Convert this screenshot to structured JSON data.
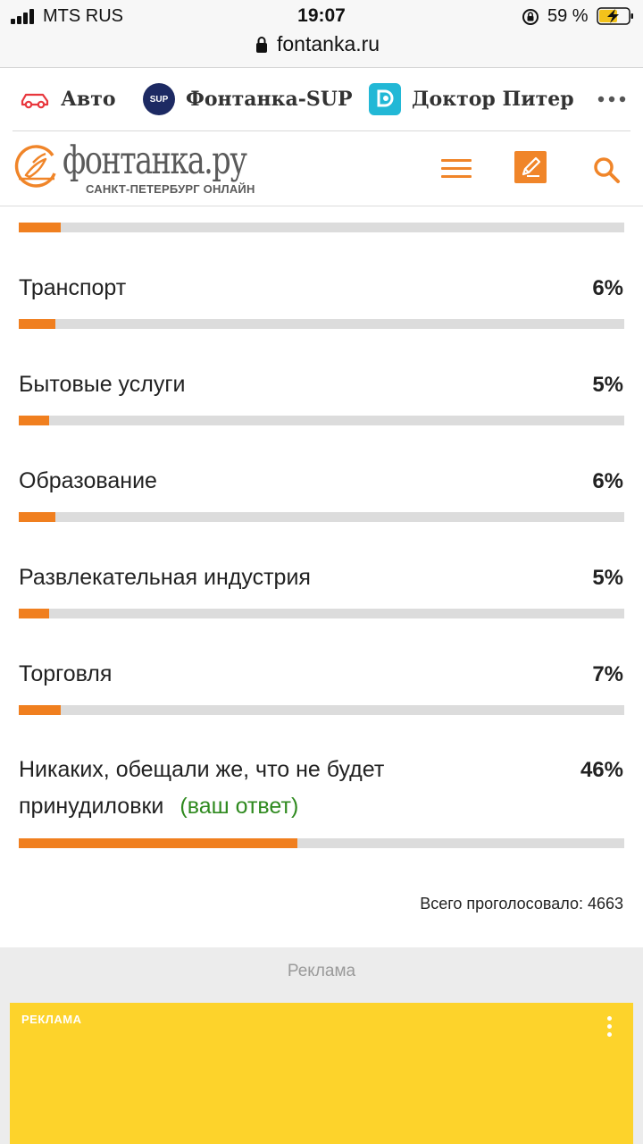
{
  "status_bar": {
    "carrier": "MTS RUS",
    "time": "19:07",
    "battery": "59 %"
  },
  "browser": {
    "url": "fontanka.ru"
  },
  "services": {
    "items": [
      {
        "label": "Авто",
        "icon": "car-icon"
      },
      {
        "label": "Фонтанка-SUP",
        "icon": "sup-logo",
        "icon_text": "SUP"
      },
      {
        "label": "Доктор Питер",
        "icon": "doctor-piter-logo"
      }
    ],
    "more_icon": "more-dots-icon"
  },
  "site_header": {
    "logo_text": "фонтанка.ру",
    "logo_subtitle": "САНКТ-ПЕТЕРБУРГ ОНЛАЙН",
    "accent_color": "#f08529"
  },
  "poll": {
    "options": [
      {
        "label": "",
        "percent": "",
        "fill": 0.07
      },
      {
        "label": "Транспорт",
        "percent": "6%",
        "fill": 0.06
      },
      {
        "label": "Бытовые услуги",
        "percent": "5%",
        "fill": 0.05
      },
      {
        "label": "Образование",
        "percent": "6%",
        "fill": 0.06
      },
      {
        "label": "Развлекательная индустрия",
        "percent": "5%",
        "fill": 0.05
      },
      {
        "label": "Торговля",
        "percent": "7%",
        "fill": 0.07
      },
      {
        "label_line1": "Никаких, обещали же, что не будет",
        "label_line2": "принудиловки",
        "your_answer": "(ваш ответ)",
        "percent": "46%",
        "fill": 0.46
      }
    ],
    "total_label": "Всего проголосовало: 4663",
    "bar_color": "#f07f1f",
    "track_color": "#dcdcdc",
    "your_answer_color": "#2f8a1f"
  },
  "ad": {
    "zone_label": "Реклама",
    "banner_tag": "РЕКЛАМА",
    "banner_color": "#fdd32b"
  }
}
